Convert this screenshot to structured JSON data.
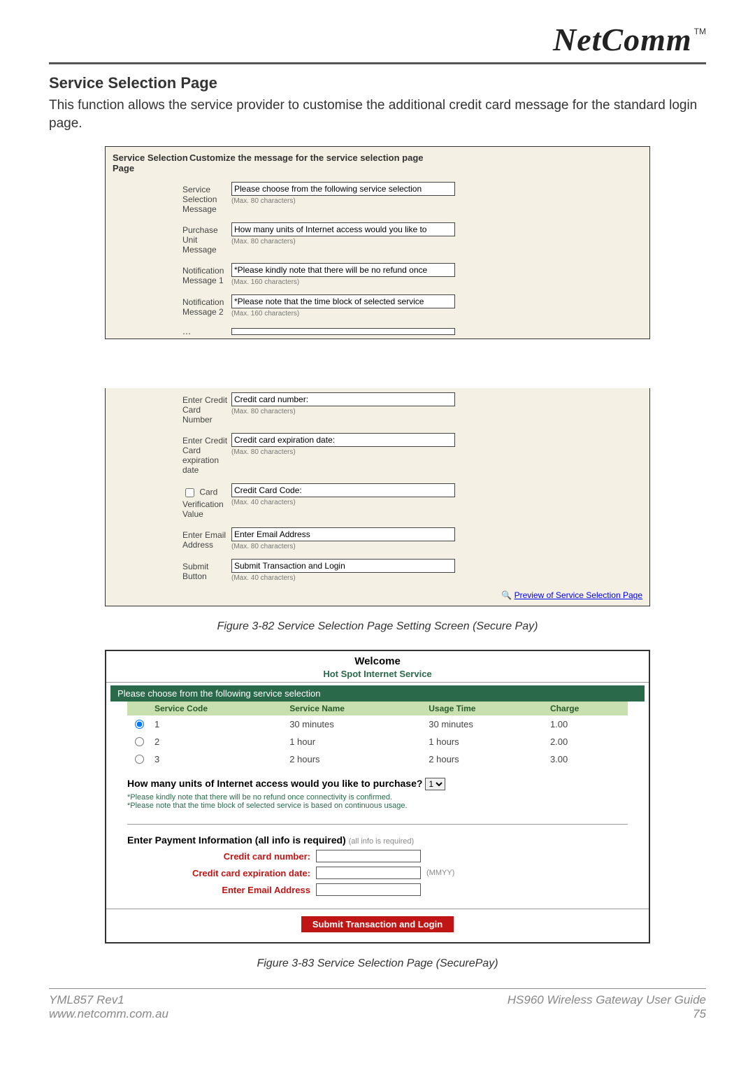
{
  "brand": {
    "name": "NetComm",
    "tm": "TM"
  },
  "section": {
    "title": "Service Selection Page"
  },
  "intro": "This function allows the service provider to customise the additional credit card message for the standard login page.",
  "panel1": {
    "heading_left": "Service Selection Page",
    "heading_right": "Customize the message for the service selection page",
    "rows": {
      "svc_sel": {
        "label": "Service Selection Message",
        "value": "Please choose from the following service selection",
        "hint": "(Max. 80 characters)"
      },
      "purchase": {
        "label": "Purchase Unit Message",
        "value": "How many units of Internet access would you like to",
        "hint": "(Max. 80 characters)"
      },
      "notif1": {
        "label": "Notification Message 1",
        "value": "*Please kindly note that there will be no refund once",
        "hint": "(Max. 160 characters)"
      },
      "notif2": {
        "label": "Notification Message 2",
        "value": "*Please note that the time block of selected service",
        "hint": "(Max. 160 characters)"
      }
    }
  },
  "panel2": {
    "rows": {
      "ccnum": {
        "label": "Enter Credit Card Number",
        "value": "Credit card number:",
        "hint": "(Max. 80 characters)"
      },
      "ccexp": {
        "label": "Enter Credit Card expiration date",
        "value": "Credit card expiration date:",
        "hint": "(Max. 80 characters)"
      },
      "cvv": {
        "label": "Card Verification Value",
        "chk": true,
        "value": "Credit Card Code:",
        "hint": "(Max. 40 characters)"
      },
      "email": {
        "label": "Enter Email Address",
        "value": "Enter Email Address",
        "hint": "(Max. 80 characters)"
      },
      "submit": {
        "label": "Submit Button",
        "value": "Submit Transaction and Login",
        "hint": "(Max. 40 characters)"
      }
    },
    "preview_link": "Preview of Service Selection Page"
  },
  "figcap1": "Figure 3-82 Service Selection Page Setting Screen (Secure Pay)",
  "preview": {
    "welcome": "Welcome",
    "subtitle": "Hot Spot Internet Service",
    "greenband": "Please choose from the following service selection",
    "headers": {
      "code": "Service Code",
      "name": "Service Name",
      "usage": "Usage Time",
      "charge": "Charge"
    },
    "rows": [
      {
        "code": "1",
        "name": "30 minutes",
        "usage": "30 minutes",
        "charge": "1.00"
      },
      {
        "code": "2",
        "name": "1 hour",
        "usage": "1 hours",
        "charge": "2.00"
      },
      {
        "code": "3",
        "name": "2 hours",
        "usage": "2 hours",
        "charge": "3.00"
      }
    ],
    "purchase_q": "How many units of Internet access would you like to purchase?",
    "unit_default": "1",
    "note1": "*Please kindly note that there will be no refund once connectivity is confirmed.",
    "note2": "*Please note that the time block of selected service is based on continuous usage.",
    "payinfo": "Enter Payment Information (all info is required)",
    "allinfo": "(all info is required)",
    "labels": {
      "ccnum": "Credit card number:",
      "ccexp": "Credit card expiration date:",
      "email": "Enter Email Address"
    },
    "mmyy": "(MMYY)",
    "submit": "Submit Transaction and Login"
  },
  "figcap2": "Figure 3-83 Service Selection Page (SecurePay)",
  "footer": {
    "left1": "YML857 Rev1",
    "left2": "www.netcomm.com.au",
    "right1": "HS960 Wireless Gateway User Guide",
    "right2": "75"
  }
}
